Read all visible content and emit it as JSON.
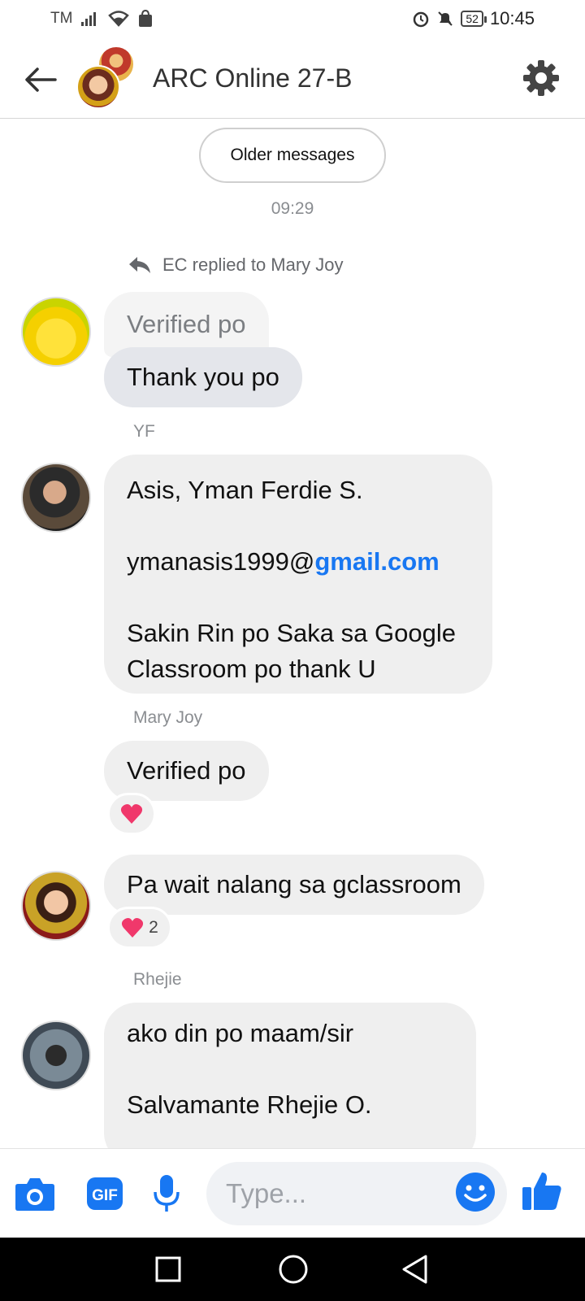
{
  "status_bar": {
    "carrier": "TM",
    "time": "10:45",
    "battery": "52"
  },
  "header": {
    "title": "ARC Online 27-B"
  },
  "messages": {
    "older_label": "Older messages",
    "timestamp": "09:29",
    "reply_note": "EC replied to Mary Joy",
    "quoted_text": "Verified po",
    "thanks_text": "Thank you po",
    "yf_sender": "YF",
    "yf_line1": "Asis, Yman Ferdie S.",
    "yf_email_user": "ymanasis1999@",
    "yf_email_domain": "gmail.com",
    "yf_line3": "Sakin Rin po Saka sa Google Classroom po thank U",
    "mj_sender": "Mary Joy",
    "mj_text": "Verified po",
    "wait_text": "Pa wait nalang sa gclassroom",
    "wait_reaction_count": "2",
    "rhejie_sender": "Rhejie",
    "rhejie_line1": "ako din po maam/sir",
    "rhejie_line2": "Salvamante Rhejie O."
  },
  "composer": {
    "placeholder": "Type..."
  },
  "colors": {
    "accent": "#1877f2",
    "bubble": "#efefef",
    "heart": "#f0386b"
  }
}
